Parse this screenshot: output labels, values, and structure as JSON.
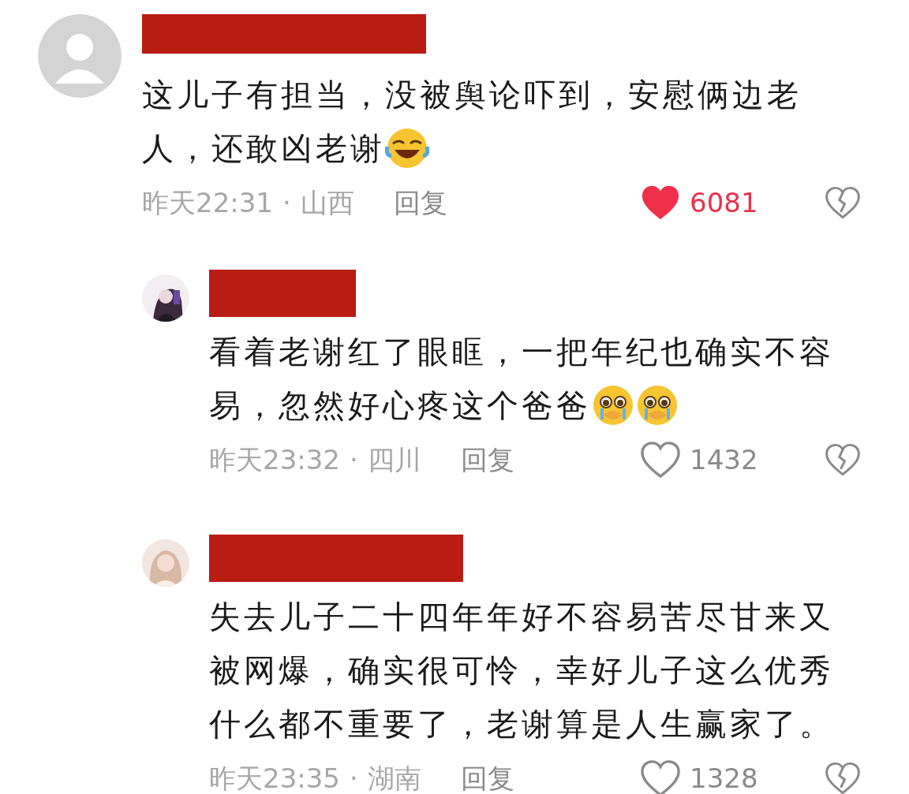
{
  "comments": [
    {
      "avatar": {
        "kind": "default"
      },
      "author_redacted": true,
      "text_lines": [
        "这儿子有担当，没被舆论吓到，安慰俩边老",
        "人，还敢凶老谢"
      ],
      "emojis": [
        {
          "kind": "grin-tears"
        }
      ],
      "time": "昨天22:31",
      "separator": "·",
      "location": "山西",
      "reply": "回复",
      "liked": true,
      "likes": "6081",
      "reply_level": false
    },
    {
      "avatar": {
        "kind": "picture"
      },
      "author_redacted": true,
      "text_lines": [
        "看着老谢红了眼眶，一把年纪也确实不容",
        "易，忽然好心疼这个爸爸"
      ],
      "emojis": [
        {
          "kind": "pleading"
        },
        {
          "kind": "pleading"
        }
      ],
      "time": "昨天23:32",
      "separator": "·",
      "location": "四川",
      "reply": "回复",
      "liked": false,
      "likes": "1432",
      "reply_level": true
    },
    {
      "avatar": {
        "kind": "picture"
      },
      "author_redacted": true,
      "text_lines": [
        "失去儿子二十四年年好不容易苦尽甘来又",
        "被网爆，确实很可怜，幸好儿子这么优秀",
        "什么都不重要了，老谢算是人生赢家了。"
      ],
      "time": "昨天23:35",
      "separator": "·",
      "location": "湖南",
      "reply": "回复",
      "liked": false,
      "likes": "1328",
      "reply_level": true
    }
  ]
}
